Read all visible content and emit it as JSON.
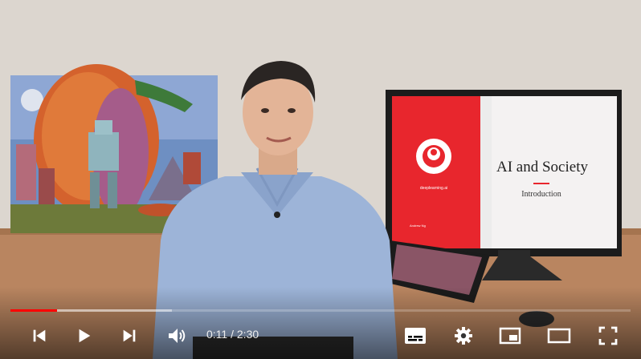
{
  "player": {
    "current_time": "0:11",
    "separator": " / ",
    "duration": "2:30",
    "progress": 0.075,
    "buffered": 0.26,
    "accent_color": "#ff0000"
  },
  "video": {
    "slide_title": "AI and Society",
    "slide_subtitle": "Introduction",
    "slide_brand": "deeplearning.ai",
    "slide_footer": "Andrew Ng",
    "slide_accent": "#e8262d"
  },
  "controls": {
    "previous_icon": "skip-previous-icon",
    "play_icon": "play-icon",
    "next_icon": "skip-next-icon",
    "volume_icon": "volume-icon",
    "subtitles_icon": "subtitles-icon",
    "settings_icon": "gear-icon",
    "miniplayer_icon": "miniplayer-icon",
    "theater_icon": "theater-mode-icon",
    "fullscreen_icon": "fullscreen-icon"
  }
}
